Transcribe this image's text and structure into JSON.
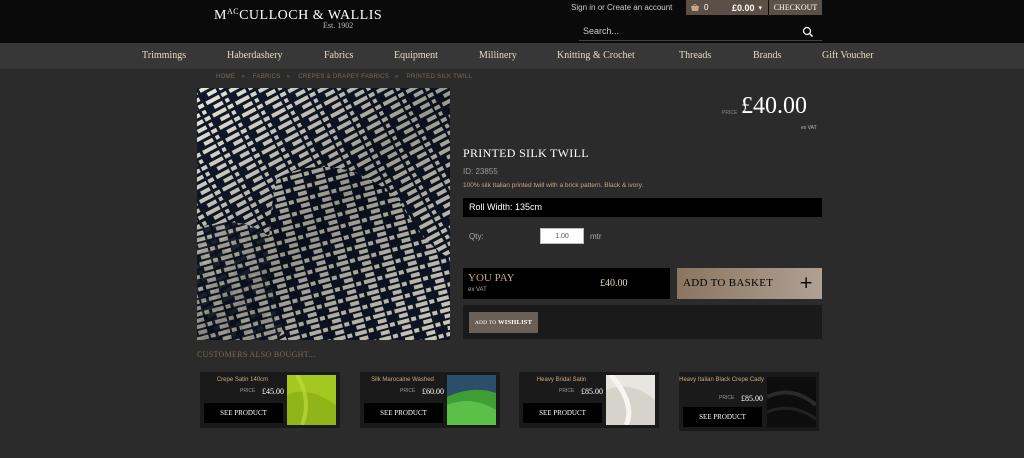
{
  "header": {
    "logo_text": "MacCULLOCH & WALLIS",
    "logo_mc": "M",
    "logo_ac": "AC",
    "logo_rest": "CULLOCH & WALLIS",
    "logo_est": "Est. 1902",
    "signin": "Sign in",
    "or": " or ",
    "create_account": "Create an account",
    "cart_count": "0",
    "cart_total": "£0.00",
    "checkout_label": "CHECKOUT",
    "search_placeholder": "Search..."
  },
  "nav": {
    "items": [
      "Trimmings",
      "Haberdashery",
      "Fabrics",
      "Equipment",
      "Millinery",
      "Knitting & Crochet",
      "Threads",
      "Brands",
      "Gift Voucher"
    ]
  },
  "breadcrumb": [
    "HOME",
    "FABRICS",
    "CREPES & DRAPEY FABRICS",
    "PRINTED SILK TWILL"
  ],
  "product": {
    "price_label": "PRICE",
    "price": "£40.00",
    "price_vat": "ex VAT",
    "title": "PRINTED SILK TWILL",
    "id": "ID: 23855",
    "description": "100% silk Italian printed twill with a brick pattern. Black & ivory.",
    "roll_width": "Roll Width: 135cm",
    "qty_label": "Qty:",
    "qty_value": "1.00",
    "qty_unit": "mtr",
    "you_pay_label": "YOU PAY",
    "you_pay_vat": "ex VAT",
    "you_pay_value": "£40.00",
    "add_basket_label": "ADD TO BASKET",
    "add_basket_plus": "+",
    "wishlist_prefix": "ADD TO ",
    "wishlist_word": "WISHLIST"
  },
  "also_bought": {
    "header": "CUSTOMERS ALSO BOUGHT...",
    "items": [
      {
        "name": "Crepe Satin 140cm",
        "price_label": "PRICE",
        "price": "£45.00",
        "cta": "SEE PRODUCT",
        "swatch": "#a3c820"
      },
      {
        "name": "Silk Marocaine Washed",
        "price_label": "PRICE",
        "price": "£60.00",
        "cta": "SEE PRODUCT",
        "swatch": "#4aa83a"
      },
      {
        "name": "Heavy Bridal Satin",
        "price_label": "PRICE",
        "price": "£85.00",
        "cta": "SEE PRODUCT",
        "swatch": "#e8e6e0"
      },
      {
        "name": "Heavy Italian Black Crepe Cady",
        "price_label": "PRICE",
        "price": "£85.00",
        "cta": "SEE PRODUCT",
        "swatch": "#111111"
      }
    ]
  },
  "colors": {
    "accent_gold": "#c8a882",
    "button_brown": "#6b6056",
    "background": "#2b2b2b"
  }
}
